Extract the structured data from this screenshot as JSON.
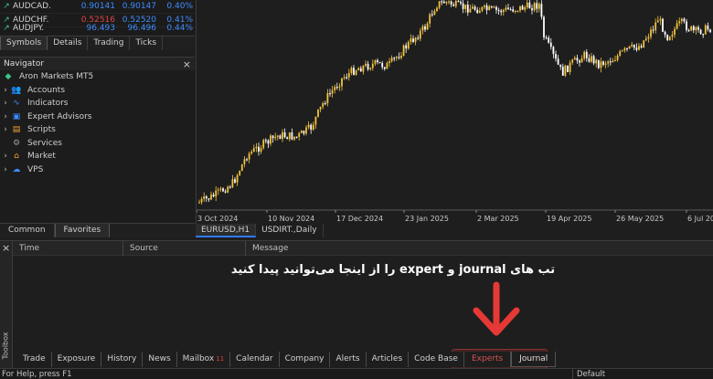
{
  "market_watch": {
    "rows": [
      {
        "symbol": "AUDCAD.",
        "bid": "0.90141",
        "ask": "0.90147",
        "change": "0.40%",
        "bid_color": "#3d8cff"
      },
      {
        "symbol": "AUDCHF.",
        "bid": "0.52516",
        "ask": "0.52520",
        "change": "0.41%",
        "bid_color": "#e04545"
      },
      {
        "symbol": "AUDJPY.",
        "bid": "96.493",
        "ask": "96.496",
        "change": "0.44%",
        "bid_color": "#3d8cff"
      }
    ],
    "tabs": [
      "Symbols",
      "Details",
      "Trading",
      "Ticks"
    ],
    "active_tab": "Symbols"
  },
  "navigator": {
    "title": "Navigator",
    "root": "Aron Markets MT5",
    "items": [
      {
        "label": "Accounts",
        "icon": "accounts-icon",
        "expandable": true,
        "color": "#3d8cff"
      },
      {
        "label": "Indicators",
        "icon": "indicators-icon",
        "expandable": true,
        "color": "#3d8cff"
      },
      {
        "label": "Expert Advisors",
        "icon": "expert-advisors-icon",
        "expandable": true,
        "color": "#3d8cff"
      },
      {
        "label": "Scripts",
        "icon": "scripts-icon",
        "expandable": true,
        "color": "#f0a030"
      },
      {
        "label": "Services",
        "icon": "services-icon",
        "expandable": false,
        "color": "#9a9a9a"
      },
      {
        "label": "Market",
        "icon": "market-icon",
        "expandable": true,
        "color": "#f0a030"
      },
      {
        "label": "VPS",
        "icon": "vps-icon",
        "expandable": true,
        "color": "#3d8cff"
      }
    ],
    "tabs": [
      "Common",
      "Favorites"
    ],
    "active_tab": "Favorites"
  },
  "chart": {
    "x_labels": [
      "3 Oct 2024",
      "10 Nov 2024",
      "17 Dec 2024",
      "23 Jan 2025",
      "2 Mar 2025",
      "19 Apr 2025",
      "26 May 2025",
      "6 Jul 2025"
    ],
    "tabs": [
      "EURUSD,H1",
      "USDIRT.,Daily"
    ],
    "active_tab": "EURUSD,H1",
    "up_color": "#f2c23c",
    "down_color": "#ffffff"
  },
  "toolbox": {
    "side_label": "Toolbox",
    "columns": [
      "Time",
      "Source",
      "Message"
    ],
    "annotation": "تب های journal و expert را از اینجا می‌توانید پیدا کنید",
    "tabs": [
      {
        "label": "Trade"
      },
      {
        "label": "Exposure"
      },
      {
        "label": "History"
      },
      {
        "label": "News"
      },
      {
        "label": "Mailbox",
        "badge": "11"
      },
      {
        "label": "Calendar"
      },
      {
        "label": "Company"
      },
      {
        "label": "Alerts"
      },
      {
        "label": "Articles"
      },
      {
        "label": "Code Base"
      },
      {
        "label": "Experts"
      },
      {
        "label": "Journal"
      }
    ],
    "highlight_color": "#e53935"
  },
  "status_bar": {
    "help_text": "For Help, press F1",
    "profile": "Default"
  }
}
